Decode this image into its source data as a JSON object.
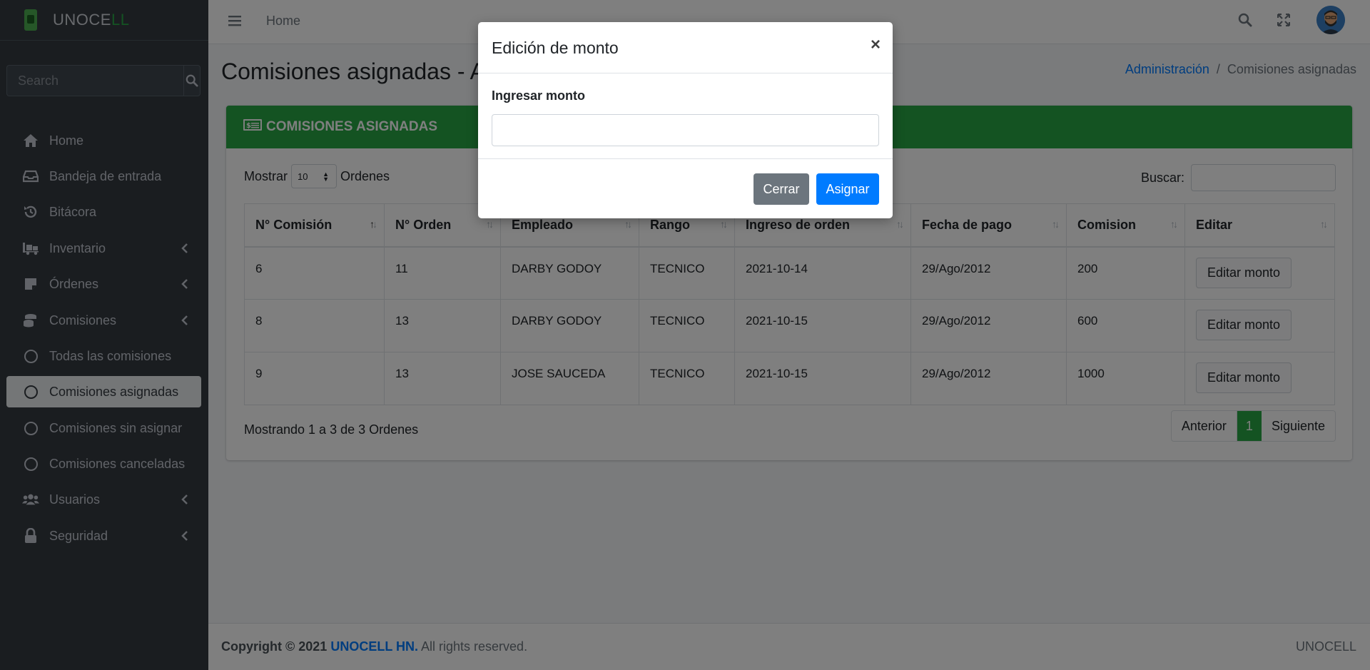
{
  "sidebar": {
    "brand": {
      "main": "UNOCE",
      "accent": "LL"
    },
    "search_placeholder": "Search",
    "items": [
      {
        "label": "Home",
        "icon": "home-icon"
      },
      {
        "label": "Bandeja de entrada",
        "icon": "inbox-icon"
      },
      {
        "label": "Bitácora",
        "icon": "history-icon"
      },
      {
        "label": "Inventario",
        "icon": "truck-icon"
      },
      {
        "label": "Órdenes",
        "icon": "sticky-note-icon"
      },
      {
        "label": "Comisiones",
        "icon": "coins-icon"
      },
      {
        "label": "Todas las comisiones",
        "icon": "circle-icon"
      },
      {
        "label": "Comisiones asignadas",
        "icon": "circle-icon"
      },
      {
        "label": "Comisiones sin asignar",
        "icon": "circle-icon"
      },
      {
        "label": "Comisiones canceladas",
        "icon": "circle-icon"
      },
      {
        "label": "Usuarios",
        "icon": "users-icon"
      },
      {
        "label": "Seguridad",
        "icon": "lock-icon"
      }
    ]
  },
  "topbar": {
    "home": "Home"
  },
  "page": {
    "title": "Comisiones asignadas - Ad",
    "breadcrumb": {
      "link": "Administración",
      "sep": "/",
      "current": "Comisiones asignadas"
    }
  },
  "card": {
    "title": "COMISIONES ASIGNADAS",
    "show_label": "Mostrar",
    "show_value": "10",
    "show_suffix": "Ordenes",
    "search_label": "Buscar:",
    "columns": [
      "N° Comisión",
      "N° Orden",
      "Empleado",
      "Rango",
      "Ingreso de orden",
      "Fecha de pago",
      "Comision",
      "Editar"
    ],
    "rows": [
      {
        "comision": "6",
        "orden": "11",
        "empleado": "DARBY GODOY",
        "rango": "TECNICO",
        "ingreso": "2021-10-14",
        "pago": "29/Ago/2012",
        "monto": "200",
        "accion": "Editar monto"
      },
      {
        "comision": "8",
        "orden": "13",
        "empleado": "DARBY GODOY",
        "rango": "TECNICO",
        "ingreso": "2021-10-15",
        "pago": "29/Ago/2012",
        "monto": "600",
        "accion": "Editar monto"
      },
      {
        "comision": "9",
        "orden": "13",
        "empleado": "JOSE SAUCEDA",
        "rango": "TECNICO",
        "ingreso": "2021-10-15",
        "pago": "29/Ago/2012",
        "monto": "1000",
        "accion": "Editar monto"
      }
    ],
    "showing": "Mostrando 1 a 3 de 3 Ordenes",
    "pager": {
      "prev": "Anterior",
      "current": "1",
      "next": "Siguiente"
    }
  },
  "footer": {
    "copyright": "Copyright © 2021",
    "brand": "UNOCELL HN.",
    "rights": "All rights reserved.",
    "right": "UNOCELL"
  },
  "modal": {
    "title": "Edición de monto",
    "close_symbol": "×",
    "label": "Ingresar monto",
    "input_value": "",
    "cancel": "Cerrar",
    "submit": "Asignar"
  },
  "colors": {
    "sidebar_bg": "#343a40",
    "success": "#28a745",
    "primary": "#007bff",
    "secondary": "#6c757d"
  }
}
